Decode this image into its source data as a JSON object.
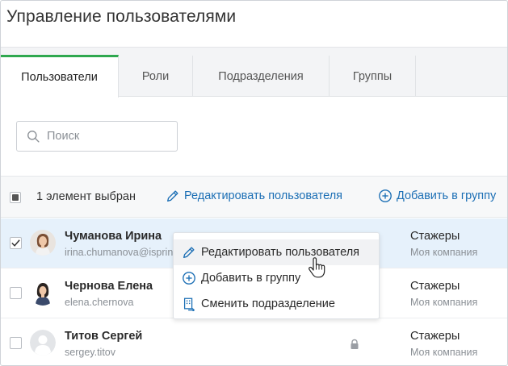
{
  "page": {
    "title": "Управление пользователями"
  },
  "tabs": [
    {
      "label": "Пользователи",
      "active": true
    },
    {
      "label": "Роли",
      "active": false
    },
    {
      "label": "Подразделения",
      "active": false
    },
    {
      "label": "Группы",
      "active": false
    }
  ],
  "search": {
    "placeholder": "Поиск",
    "value": "",
    "icon": "search-icon"
  },
  "toolbar": {
    "selected_text": "1 элемент выбран",
    "edit_label": "Редактировать пользователя",
    "add_label": "Добавить в группу"
  },
  "users": [
    {
      "name": "Чуманова Ирина",
      "login": "irina.chumanova@ispring",
      "group": "Стажеры",
      "company": "Моя компания",
      "checked": true,
      "avatar": "female-photo"
    },
    {
      "name": "Чернова Елена",
      "login": "elena.chernova",
      "group": "Стажеры",
      "company": "Моя компания",
      "checked": false,
      "avatar": "female-photo"
    },
    {
      "name": "Титов Сергей",
      "login": "sergey.titov",
      "group": "Стажеры",
      "company": "Моя компания",
      "checked": false,
      "avatar": "placeholder-avatar",
      "locked": true
    }
  ],
  "context_menu": {
    "items": [
      {
        "label": "Редактировать пользователя",
        "icon": "pencil-icon"
      },
      {
        "label": "Добавить в группу",
        "icon": "plus-circle-icon"
      },
      {
        "label": "Сменить подразделение",
        "icon": "building-swap-icon"
      }
    ]
  },
  "colors": {
    "accent_green": "#2fa84f",
    "link_blue": "#1c6fb5",
    "selected_row": "#e6f1fb"
  }
}
